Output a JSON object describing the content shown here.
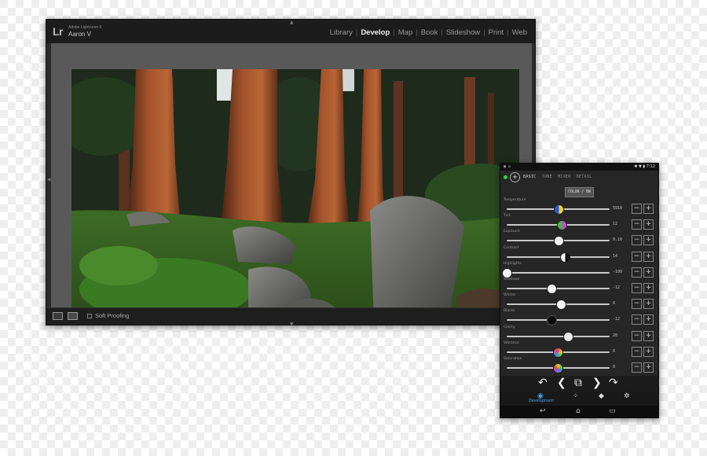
{
  "lightroom": {
    "logo": "Lr",
    "version": "Adobe Lightroom 6",
    "user": "Aaron V",
    "modules": [
      {
        "label": "Library",
        "active": false
      },
      {
        "label": "Develop",
        "active": true
      },
      {
        "label": "Map",
        "active": false
      },
      {
        "label": "Book",
        "active": false
      },
      {
        "label": "Slideshow",
        "active": false
      },
      {
        "label": "Print",
        "active": false
      },
      {
        "label": "Web",
        "active": false
      }
    ],
    "toolbar": {
      "soft_proofing_label": "Soft Proofing"
    },
    "photo_subject": "sequoia-forest-photo"
  },
  "phone": {
    "status": {
      "left_icons": "▣ ✉",
      "right_icons": "✱ ▼ ▮ 7:12"
    },
    "tabs": [
      {
        "label": "BASIC",
        "active": true
      },
      {
        "label": "TONE",
        "active": false
      },
      {
        "label": "MIXER",
        "active": false
      },
      {
        "label": "DETAIL",
        "active": false
      }
    ],
    "color_bw_label": "COLOR / BW",
    "sliders": [
      {
        "label": "Temperature",
        "value": "5910",
        "level": 0.51,
        "knob": "k-temp"
      },
      {
        "label": "Tint",
        "value": "12",
        "level": 0.54,
        "knob": "k-tint"
      },
      {
        "label": "Exposure",
        "value": "0.10",
        "level": 0.51,
        "knob": "k-exp"
      },
      {
        "label": "Contrast",
        "value": "14",
        "level": 0.57,
        "knob": "k-con"
      },
      {
        "label": "Highlights",
        "value": "-100",
        "level": 0.0,
        "knob": "k-hl"
      },
      {
        "label": "Shadows",
        "value": "-12",
        "level": 0.44,
        "knob": "k-sh"
      },
      {
        "label": "Whites",
        "value": "6",
        "level": 0.53,
        "knob": "k-wh"
      },
      {
        "label": "Blacks",
        "value": "-12",
        "level": 0.44,
        "knob": "k-bl"
      },
      {
        "label": "Clarity",
        "value": "20",
        "level": 0.6,
        "knob": "k-cl"
      },
      {
        "label": "Vibrance",
        "value": "0",
        "level": 0.5,
        "knob": "k-vib"
      },
      {
        "label": "Saturation",
        "value": "0",
        "level": 0.5,
        "knob": "k-sat"
      }
    ],
    "stepper": {
      "minus": "−",
      "plus": "+"
    },
    "controls": {
      "undo": "↶",
      "prev": "❮",
      "compare": "⧉",
      "next": "❯",
      "redo": "↷"
    },
    "bottom_nav": {
      "development_label": "Development"
    },
    "sysnav": {
      "back": "↩",
      "home": "⌂",
      "recent": "▭"
    }
  }
}
